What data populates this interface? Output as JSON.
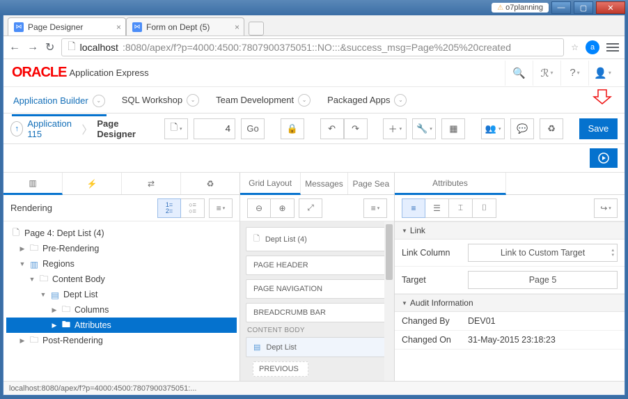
{
  "window": {
    "tag": "o7planning"
  },
  "browser": {
    "tabs": [
      {
        "title": "Page Designer",
        "active": true
      },
      {
        "title": "Form on Dept (5)",
        "active": false
      }
    ],
    "url_host": "localhost",
    "url_path": ":8080/apex/f?p=4000:4500:7807900375051::NO:::&success_msg=Page%205%20created",
    "status": "localhost:8080/apex/f?p=4000:4500:7807900375051:..."
  },
  "oracle": {
    "logo": "ORACLE",
    "product": "Application Express",
    "menu": [
      "Application Builder",
      "SQL Workshop",
      "Team Development",
      "Packaged Apps"
    ]
  },
  "breadcrumb": {
    "app": "Application 115",
    "page": "Page Designer",
    "page_num": "4",
    "go": "Go",
    "save": "Save"
  },
  "left": {
    "title": "Rendering",
    "tree": {
      "root": "Page 4: Dept List (4)",
      "pre": "Pre-Rendering",
      "regions": "Regions",
      "content_body": "Content Body",
      "dept_list": "Dept List",
      "columns": "Columns",
      "attributes": "Attributes",
      "post": "Post-Rendering"
    }
  },
  "mid": {
    "tabs": [
      "Grid Layout",
      "Messages",
      "Page Sea"
    ],
    "items": {
      "dept": "Dept List (4)",
      "page_header": "PAGE HEADER",
      "page_nav": "PAGE NAVIGATION",
      "breadcrumb_bar": "BREADCRUMB BAR",
      "content_body": "CONTENT BODY",
      "dept_region": "Dept List",
      "previous": "PREVIOUS"
    }
  },
  "right": {
    "tab": "Attributes",
    "groups": {
      "link": "Link",
      "audit": "Audit Information"
    },
    "props": {
      "link_column_k": "Link Column",
      "link_column_v": "Link to Custom Target",
      "target_k": "Target",
      "target_v": "Page 5",
      "changed_by_k": "Changed By",
      "changed_by_v": "DEV01",
      "changed_on_k": "Changed On",
      "changed_on_v": "31-May-2015 23:18:23"
    }
  }
}
